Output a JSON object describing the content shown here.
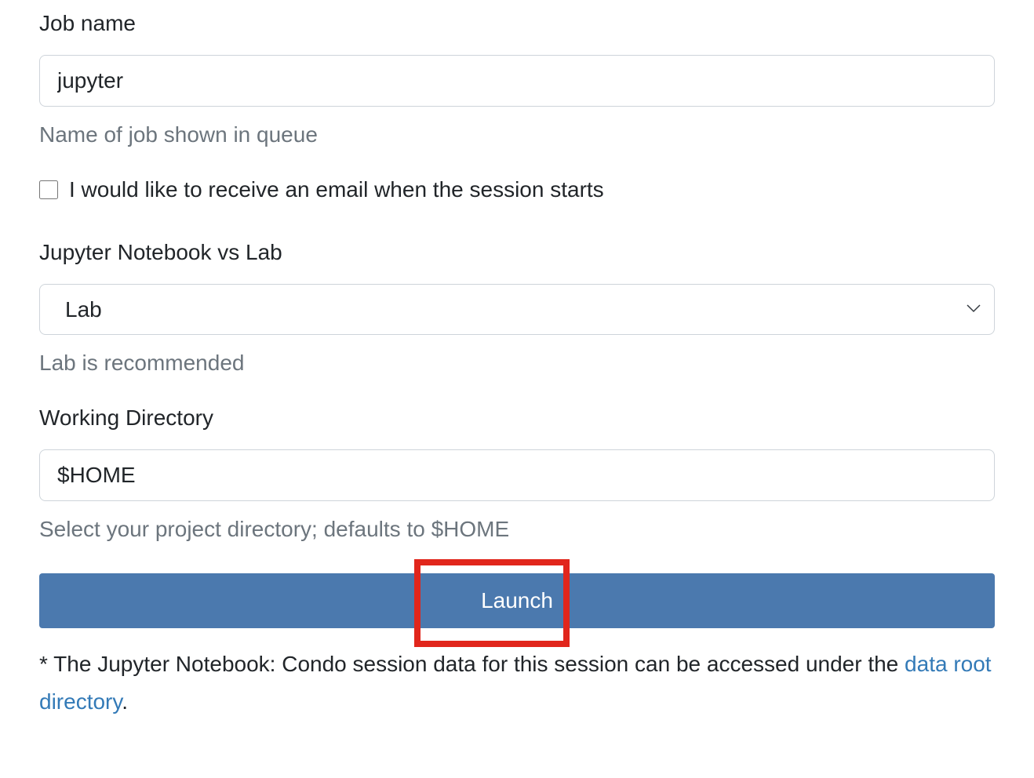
{
  "form": {
    "jobName": {
      "label": "Job name",
      "value": "jupyter",
      "help": "Name of job shown in queue"
    },
    "emailNotify": {
      "label": "I would like to receive an email when the session starts",
      "checked": false
    },
    "mode": {
      "label": "Jupyter Notebook vs Lab",
      "selected": "Lab",
      "help": "Lab is recommended"
    },
    "workingDir": {
      "label": "Working Directory",
      "value": "$HOME",
      "help": "Select your project directory; defaults to $HOME"
    },
    "launch": {
      "label": "Launch"
    }
  },
  "footnote": {
    "prefix": "* The Jupyter Notebook: Condo session data for this session can be accessed under the ",
    "linkText": "data root directory",
    "suffix": "."
  }
}
